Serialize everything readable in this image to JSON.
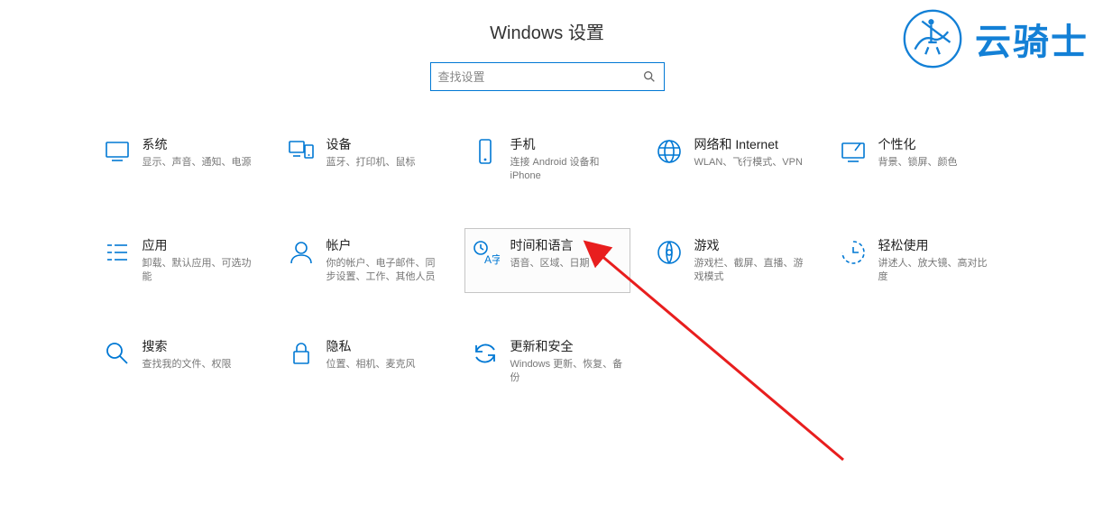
{
  "title": "Windows 设置",
  "search": {
    "placeholder": "查找设置"
  },
  "watermark": "云骑士",
  "tiles": {
    "system": {
      "title": "系统",
      "desc": "显示、声音、通知、电源"
    },
    "devices": {
      "title": "设备",
      "desc": "蓝牙、打印机、鼠标"
    },
    "phone": {
      "title": "手机",
      "desc": "连接 Android 设备和 iPhone"
    },
    "network": {
      "title": "网络和 Internet",
      "desc": "WLAN、飞行模式、VPN"
    },
    "personal": {
      "title": "个性化",
      "desc": "背景、锁屏、颜色"
    },
    "apps": {
      "title": "应用",
      "desc": "卸载、默认应用、可选功能"
    },
    "accounts": {
      "title": "帐户",
      "desc": "你的帐户、电子邮件、同步设置、工作、其他人员"
    },
    "time": {
      "title": "时间和语言",
      "desc": "语音、区域、日期"
    },
    "gaming": {
      "title": "游戏",
      "desc": "游戏栏、截屏、直播、游戏模式"
    },
    "ease": {
      "title": "轻松使用",
      "desc": "讲述人、放大镜、高对比度"
    },
    "search_cat": {
      "title": "搜索",
      "desc": "查找我的文件、权限"
    },
    "privacy": {
      "title": "隐私",
      "desc": "位置、相机、麦克风"
    },
    "update": {
      "title": "更新和安全",
      "desc": "Windows 更新、恢复、备份"
    }
  }
}
